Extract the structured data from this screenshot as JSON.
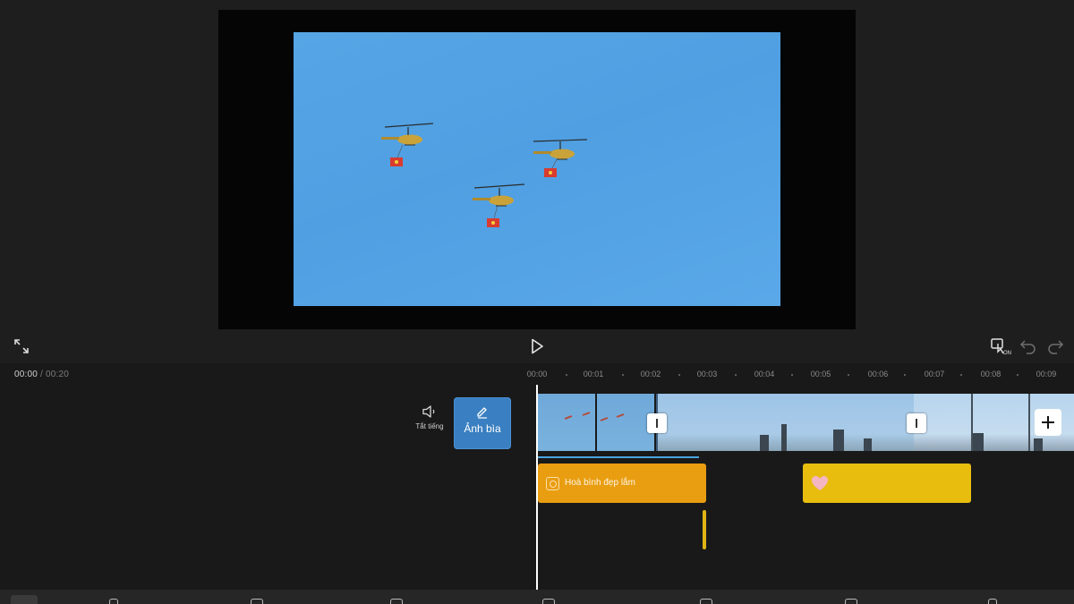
{
  "preview": {
    "canvas_background": "#050505",
    "sky_color": "#56a6e6"
  },
  "controls": {
    "fullscreen_icon": "expand-icon",
    "play_icon": "play-icon",
    "keyframe_icon": "keyframe-on-icon",
    "keyframe_badge": "ON",
    "undo_icon": "undo-icon",
    "redo_icon": "redo-icon"
  },
  "timeline": {
    "current_time": "00:00",
    "separator": "/",
    "total_time": "00:20",
    "ruler_ticks": [
      "00:00",
      "00:01",
      "00:02",
      "00:03",
      "00:04",
      "00:05",
      "00:06",
      "00:07",
      "00:08",
      "00:09"
    ],
    "mute_label": "Tắt tiếng",
    "cover_label": "Ảnh bìa",
    "text_clip_label": "Hoà bình đẹp lắm",
    "playhead_color": "#ffffff",
    "text_clip_color": "#e99d10",
    "sticker_clip_color": "#e8bd0e",
    "cover_button_color": "#3a7fc1"
  }
}
